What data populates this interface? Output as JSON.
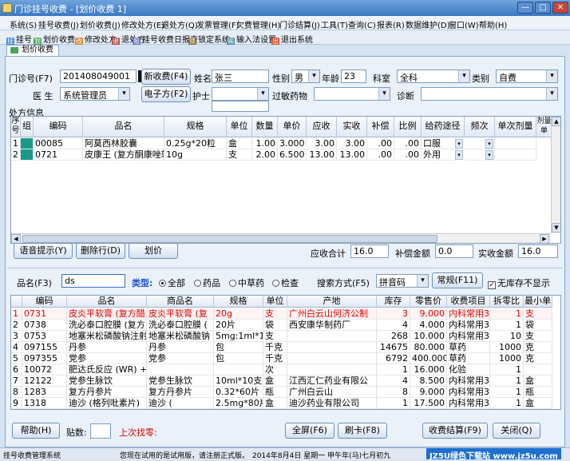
{
  "window": {
    "title": "门诊挂号收费 - [划价收费 1]",
    "min": "—",
    "max": "□",
    "close": "✕"
  },
  "menu": [
    "系统(S)",
    "挂号收费(J)",
    "划价收费(J)",
    "修改处方(E)",
    "退处方(Q)",
    "发票管理(F)",
    "欠费管理(H)",
    "门诊结算(J)",
    "工具(T)",
    "查询(C)",
    "报表(R)",
    "数据维护(D)",
    "窗口(W)",
    "帮助(H)"
  ],
  "toolbar": [
    "挂号",
    "划价收费",
    "修改处方",
    "退处方",
    "挂号收费日报表",
    "锁定系统",
    "输入法设置",
    "退出系统"
  ],
  "tab": "划价收费 1",
  "form": {
    "mzh_label": "门诊号(F7)",
    "mzh_value": "201408049001",
    "new_fee_btn": "新收费(F4)",
    "name_label": "姓名",
    "name_value": "张三",
    "sex_label": "性别",
    "sex_value": "男",
    "age_label": "年龄",
    "age_value": "23",
    "dept_label": "科室",
    "dept_value": "全科",
    "type_label": "类别",
    "type_value": "自费",
    "doctor_label": "医 生",
    "doctor_value": "系统管理员",
    "erx_btn": "电子方(F2)",
    "nurse_label": "护士",
    "allergy_label": "过敏药物",
    "diag_label": "诊断"
  },
  "rx": {
    "section_label": "处方信息",
    "headers": [
      "序号",
      "组",
      "编码",
      "品名",
      "规格",
      "单位",
      "数量",
      "单价",
      "应收",
      "实收",
      "补偿",
      "比例",
      "给药途径",
      "频次",
      "单次剂量",
      "剂量单"
    ],
    "rows": [
      [
        "1",
        "",
        "00085",
        "阿莫西林胶囊",
        "0.25g*20粒",
        "盒",
        "1.00",
        "3.000",
        "3.00",
        "3.00",
        ".00",
        ".00",
        "口服",
        "",
        ""
      ],
      [
        "2",
        "",
        "0721",
        "皮康王 (复方酮康唑软",
        "10g",
        "支",
        "2.00",
        "6.500",
        "13.00",
        "13.00",
        ".00",
        ".00",
        "外用",
        "",
        ""
      ]
    ]
  },
  "summary": {
    "voice_btn": "语音提示(Y)",
    "del_btn": "删除行(D)",
    "price_btn": "划价",
    "recv_label": "应收合计",
    "recv_value": "16.0",
    "comp_label": "补偿金额",
    "comp_value": "0.0",
    "actual_label": "实收金额",
    "actual_value": "16.0"
  },
  "search": {
    "name_label": "品名(F3)",
    "name_value": "ds",
    "type_label": "类型:",
    "types": [
      "全部",
      "药品",
      "中草药",
      "检查"
    ],
    "mode_label": "搜索方式(F5)",
    "mode_value": "拼音码",
    "normal_btn": "常规(F11)",
    "nostock_label": "无库存不显示"
  },
  "drugs": {
    "headers": [
      "",
      "编码",
      "品名",
      "商品名",
      "规格",
      "单位",
      "产地",
      "库存",
      "零售价",
      "收费项目",
      "拆零比",
      "最小单"
    ],
    "rows": [
      [
        "1",
        "0731",
        "皮炎平软膏 (复方醋",
        "皮炎平软膏 (复",
        "20g",
        "支",
        "广州白云山何济公制",
        "3",
        "9.000",
        "内科常用3",
        "1",
        "支"
      ],
      [
        "2",
        "0738",
        "洗必泰口腔膜 (复方",
        "洗必泰口腔膜 (",
        "20片",
        "袋",
        "西安康华制药厂",
        "4",
        "4.000",
        "内科常用3",
        "1",
        "袋"
      ],
      [
        "3",
        "0753",
        "地塞米松磷酸钠注射",
        "地塞米松磷酸钠",
        "5mg:1ml*10",
        "支",
        "",
        "268",
        "10.000",
        "内科常用3",
        "10",
        "支"
      ],
      [
        "4",
        "097155",
        "丹参",
        "丹参",
        "包",
        "千克",
        "",
        "14675",
        "80.000",
        "草药",
        "1000",
        "克"
      ],
      [
        "5",
        "097355",
        "党参",
        "党参",
        "包",
        "千克",
        "",
        "6792",
        "400.000",
        "草药",
        "1000",
        "克"
      ],
      [
        "6",
        "10072",
        "肥达氏反应 (WR) +",
        "",
        "",
        "次",
        "",
        "1",
        "16.000",
        "化验",
        "1",
        ""
      ],
      [
        "7",
        "12122",
        "党参生脉饮",
        "党参生脉饮",
        "10ml*10支",
        "盒",
        "江西汇仁药业有限公",
        "4",
        "8.500",
        "内科常用3",
        "1",
        "盒"
      ],
      [
        "8",
        "1283",
        "复方丹参片",
        "复方丹参片",
        "0.32*60片",
        "瓶",
        "广州白云山",
        "8",
        "9.000",
        "内科常用3",
        "1",
        "瓶"
      ],
      [
        "9",
        "1318",
        "迪沙 (格列吡素片)",
        "迪沙 (",
        "2.5mg*80片",
        "盒",
        "迪沙药业有限公司",
        "1",
        "17.500",
        "内科常用3",
        "1",
        "盒"
      ]
    ]
  },
  "bottom": {
    "help_btn": "帮助(H)",
    "stick_label": "贴数:",
    "last_change": "上次找零:",
    "full_btn": "全屏(F6)",
    "card_btn": "刷卡(F8)",
    "settle_btn": "收费结算(F9)",
    "close_btn": "关闭(Q)"
  },
  "status": {
    "app": "挂号收费管理系统",
    "notice": "您现在试用的是试用版，请注册正式版。",
    "date": "2014年8月4日 星期一  甲午年(马)七月初九",
    "watermark": "JZ5U绿色下载站 www.jz5u.com"
  },
  "colors": {
    "red_text": "#e00000",
    "blue_label": "#1b4fd6",
    "title_bg": "#3b78c2"
  }
}
